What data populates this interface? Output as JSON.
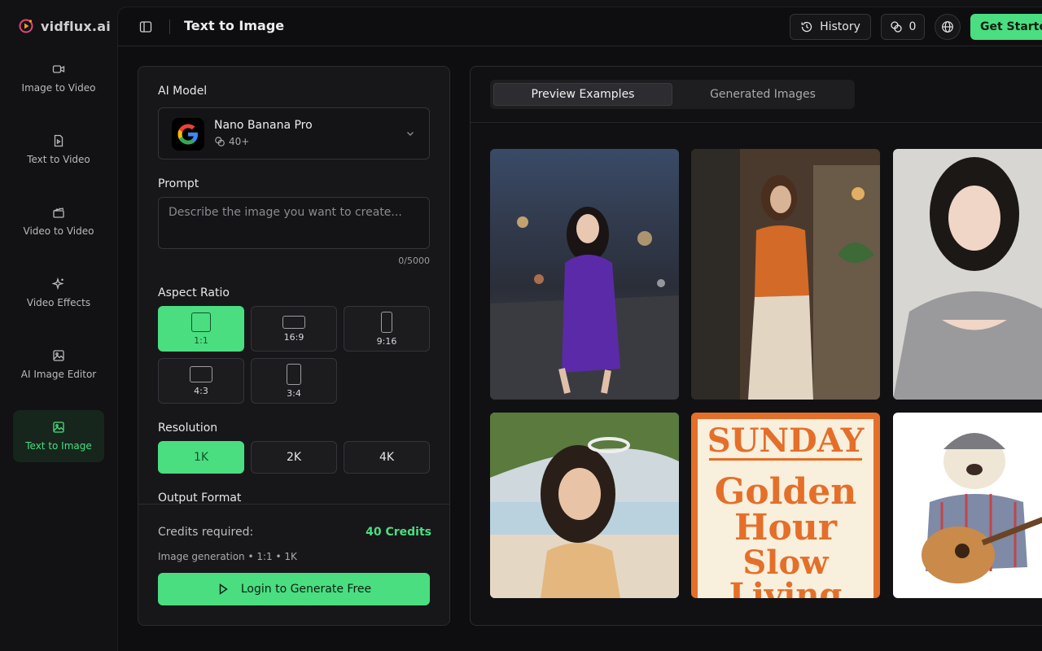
{
  "brand": {
    "name": "vidflux.ai"
  },
  "sidebar": {
    "items": [
      {
        "label": "Image to Video",
        "icon": "video-camera-icon"
      },
      {
        "label": "Text to Video",
        "icon": "document-icon"
      },
      {
        "label": "Video to Video",
        "icon": "clapperboard-icon"
      },
      {
        "label": "Video Effects",
        "icon": "sparkles-icon"
      },
      {
        "label": "AI Image Editor",
        "icon": "image-icon"
      },
      {
        "label": "Text to Image",
        "icon": "image-icon",
        "active": true
      }
    ]
  },
  "header": {
    "title": "Text to Image",
    "history_label": "History",
    "credits_count": "0",
    "get_started_label": "Get Started"
  },
  "form": {
    "model_label": "AI Model",
    "model_name": "Nano Banana Pro",
    "model_cost": "40+",
    "prompt_label": "Prompt",
    "prompt_placeholder": "Describe the image you want to create...",
    "char_count": "0/5000",
    "aspect_label": "Aspect Ratio",
    "aspect_options": [
      "1:1",
      "16:9",
      "9:16",
      "4:3",
      "3:4"
    ],
    "aspect_selected": "1:1",
    "resolution_label": "Resolution",
    "resolution_options": [
      "1K",
      "2K",
      "4K"
    ],
    "resolution_selected": "1K",
    "output_format_label": "Output Format"
  },
  "footer": {
    "credits_label": "Credits required:",
    "credits_value": "40 Credits",
    "generation_info": "Image generation • 1:1 • 1K",
    "login_button": "Login to Generate Free"
  },
  "gallery": {
    "tabs": [
      "Preview Examples",
      "Generated Images"
    ],
    "active_tab": "Preview Examples",
    "poster_lines": [
      "SUNDAY",
      "Golden",
      "Hour",
      "Slow",
      "Living"
    ]
  },
  "colors": {
    "accent": "#4ade80",
    "background": "#0e0e10",
    "panel": "#171719"
  }
}
